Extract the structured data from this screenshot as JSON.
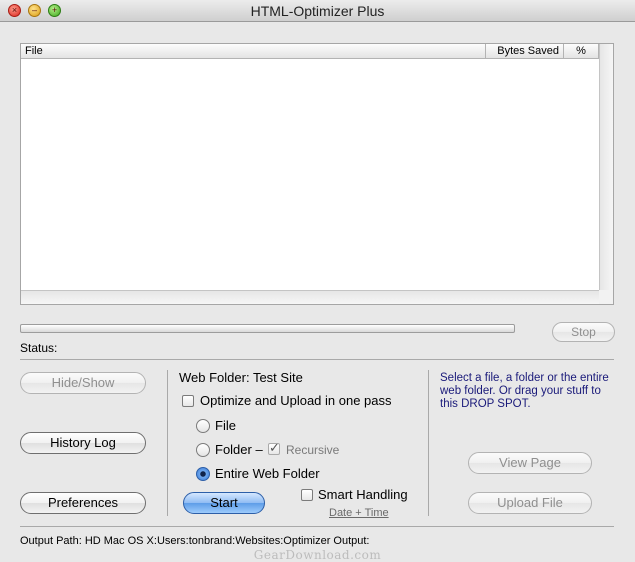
{
  "window": {
    "title": "HTML-Optimizer Plus"
  },
  "table": {
    "columns": [
      "File",
      "Bytes Saved",
      "%"
    ],
    "rows": []
  },
  "progress": {
    "value": 0
  },
  "buttons": {
    "stop": "Stop",
    "hide_show": "Hide/Show",
    "history_log": "History Log",
    "preferences": "Preferences",
    "start": "Start",
    "view_page": "View Page",
    "upload_file": "Upload File"
  },
  "status": {
    "label": "Status:",
    "value": ""
  },
  "options": {
    "web_folder_label": "Web Folder: Test Site",
    "optimize_upload": {
      "label": "Optimize and Upload in one pass",
      "checked": false
    },
    "radios": [
      {
        "label": "File",
        "selected": false
      },
      {
        "label": "Folder –",
        "selected": false
      },
      {
        "label": "Entire Web Folder",
        "selected": true
      }
    ],
    "recursive": {
      "label": "Recursive",
      "checked": true
    },
    "smart_handling": {
      "label": "Smart Handling",
      "checked": false
    },
    "date_time_link": "Date + Time"
  },
  "drop_spot_text": "Select a file, a folder or the entire web folder. Or drag your stuff to this DROP SPOT.",
  "output_path": "Output Path:  HD Mac OS X:Users:tonbrand:Websites:Optimizer Output:",
  "watermark": "GearDownload.com"
}
